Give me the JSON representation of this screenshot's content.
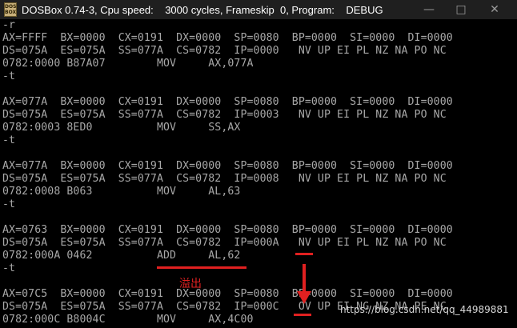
{
  "window": {
    "title": "DOSBox 0.74-3, Cpu speed:    3000 cycles, Frameskip  0, Program:    DEBUG",
    "icon_label": "DOS BOX",
    "minimize": "—",
    "maximize": "□",
    "close": "✕"
  },
  "console": {
    "lines": [
      "-r",
      "AX=FFFF  BX=0000  CX=0191  DX=0000  SP=0080  BP=0000  SI=0000  DI=0000",
      "DS=075A  ES=075A  SS=077A  CS=0782  IP=0000   NV UP EI PL NZ NA PO NC",
      "0782:0000 B87A07        MOV     AX,077A",
      "-t",
      "",
      "AX=077A  BX=0000  CX=0191  DX=0000  SP=0080  BP=0000  SI=0000  DI=0000",
      "DS=075A  ES=075A  SS=077A  CS=0782  IP=0003   NV UP EI PL NZ NA PO NC",
      "0782:0003 8ED0          MOV     SS,AX",
      "-t",
      "",
      "AX=077A  BX=0000  CX=0191  DX=0000  SP=0080  BP=0000  SI=0000  DI=0000",
      "DS=075A  ES=075A  SS=077A  CS=0782  IP=0008   NV UP EI PL NZ NA PO NC",
      "0782:0008 B063          MOV     AL,63",
      "-t",
      "",
      "AX=0763  BX=0000  CX=0191  DX=0000  SP=0080  BP=0000  SI=0000  DI=0000",
      "DS=075A  ES=075A  SS=077A  CS=0782  IP=000A   NV UP EI PL NZ NA PO NC",
      "0782:000A 0462          ADD     AL,62",
      "-t",
      "",
      "AX=07C5  BX=0000  CX=0191  DX=0000  SP=0080  BP=0000  SI=0000  DI=0000",
      "DS=075A  ES=075A  SS=077A  CS=0782  IP=000C   OV UP EI NG NZ NA PE NC",
      "0782:000C B8004C        MOV     AX,4C00"
    ]
  },
  "annotation": {
    "text": "溢出",
    "color": "#e02020"
  },
  "watermark": "https://blog.csdn.net/qq_44989881"
}
